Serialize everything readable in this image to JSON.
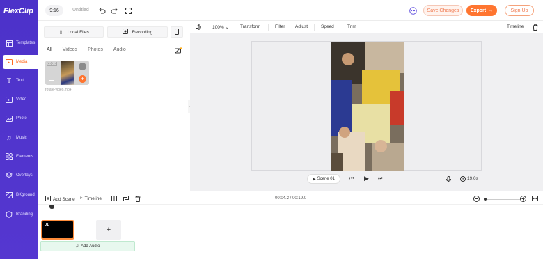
{
  "app": {
    "logo_text": "FlexClip"
  },
  "sidebar": {
    "items": [
      {
        "label": "Templates",
        "icon": "templates-icon"
      },
      {
        "label": "Media",
        "icon": "media-icon",
        "active": true
      },
      {
        "label": "Text",
        "icon": "text-icon"
      },
      {
        "label": "Video",
        "icon": "video-icon"
      },
      {
        "label": "Photo",
        "icon": "photo-icon"
      },
      {
        "label": "Music",
        "icon": "music-icon"
      },
      {
        "label": "Elements",
        "icon": "elements-icon"
      },
      {
        "label": "Overlays",
        "icon": "overlays-icon"
      },
      {
        "label": "BKground",
        "icon": "background-icon"
      },
      {
        "label": "Branding",
        "icon": "branding-icon"
      }
    ]
  },
  "topbar": {
    "ratio": "9:16",
    "project_title": "Untitled",
    "save_label": "Save Changes",
    "export_label": "Export",
    "signup_label": "Sign Up"
  },
  "media": {
    "local_files_label": "Local Files",
    "recording_label": "Recording",
    "tabs": [
      "All",
      "Videos",
      "Photos",
      "Audio"
    ],
    "active_tab": "All",
    "items": [
      {
        "duration": "00:20",
        "name": "rotate-video.mp4"
      }
    ]
  },
  "preview_toolbar": {
    "zoom": "100%",
    "items": [
      "Transform",
      "Filter",
      "Adjust",
      "Speed",
      "Trim"
    ],
    "timeline_label": "Timeline"
  },
  "preview_controls": {
    "scene_label": "Scene 01",
    "duration": "19.0s"
  },
  "timeline": {
    "add_scene_label": "Add Scene",
    "timeline_label": "Timeline",
    "time": "00:04.2 / 00:19.0",
    "clip_number": "01",
    "add_audio_label": "Add Audio"
  },
  "colors": {
    "accent": "#ff7530",
    "sidebar": "#5136cc"
  }
}
